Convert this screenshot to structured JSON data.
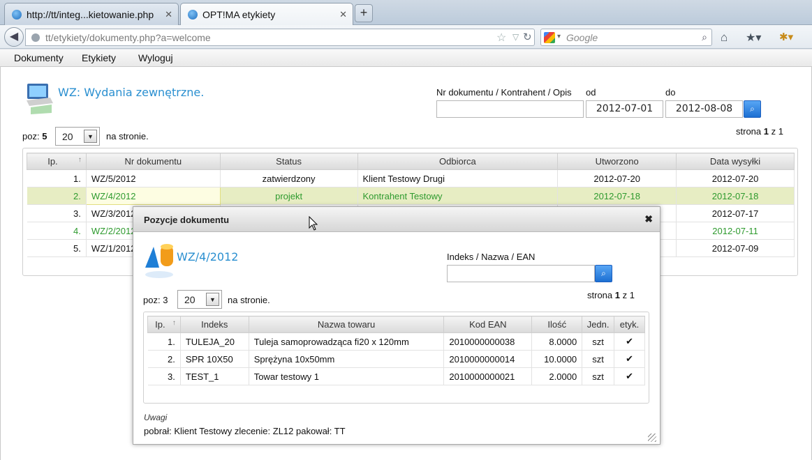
{
  "browser": {
    "tabs": [
      {
        "title": "http://tt/integ...kietowanie.php",
        "active": false
      },
      {
        "title": "OPT!MA etykiety",
        "active": true
      }
    ],
    "url": "tt/etykiety/dokumenty.php?a=welcome",
    "search_placeholder": "Google"
  },
  "menu": [
    "Dokumenty",
    "Etykiety",
    "Wyloguj"
  ],
  "page": {
    "title": "WZ: Wydania zewnętrzne.",
    "filter": {
      "search_label": "Nr dokumentu / Kontrahent / Opis",
      "search_value": "",
      "from_label": "od",
      "from_value": "2012-07-01",
      "to_label": "do",
      "to_value": "2012-08-08"
    },
    "poz_label": "poz:",
    "poz_count": "5",
    "per_page": "20",
    "per_page_suffix": "na stronie.",
    "pagination": {
      "prefix": "strona",
      "current": "1",
      "sep": "z",
      "total": "1"
    },
    "table": {
      "columns": [
        "Ip.",
        "Nr dokumentu",
        "Status",
        "Odbiorca",
        "Utworzono",
        "Data wysyłki"
      ],
      "rows": [
        {
          "lp": "1.",
          "nr": "WZ/5/2012",
          "status": "zatwierdzony",
          "odbiorca": "Klient Testowy Drugi",
          "utworzono": "2012-07-20",
          "wysylka": "2012-07-20"
        },
        {
          "lp": "2.",
          "nr": "WZ/4/2012",
          "status": "projekt",
          "odbiorca": "Kontrahent Testowy",
          "utworzono": "2012-07-18",
          "wysylka": "2012-07-18"
        },
        {
          "lp": "3.",
          "nr": "WZ/3/2012",
          "status": "",
          "odbiorca": "",
          "utworzono": "",
          "wysylka": "2012-07-17"
        },
        {
          "lp": "4.",
          "nr": "WZ/2/2012",
          "status": "",
          "odbiorca": "",
          "utworzono": "",
          "wysylka": "2012-07-11"
        },
        {
          "lp": "5.",
          "nr": "WZ/1/2012",
          "status": "",
          "odbiorca": "",
          "utworzono": "",
          "wysylka": "2012-07-09"
        }
      ]
    }
  },
  "modal": {
    "title": "Pozycje dokumentu",
    "doc_number": "WZ/4/2012",
    "search_label": "Indeks / Nazwa / EAN",
    "search_value": "",
    "poz_label": "poz:",
    "poz_count": "3",
    "per_page": "20",
    "per_page_suffix": "na stronie.",
    "pagination": {
      "prefix": "strona",
      "current": "1",
      "sep": "z",
      "total": "1"
    },
    "table": {
      "columns": [
        "Ip.",
        "Indeks",
        "Nazwa towaru",
        "Kod EAN",
        "Ilość",
        "Jedn.",
        "etyk."
      ],
      "rows": [
        {
          "lp": "1.",
          "indeks": "TULEJA_20",
          "nazwa": "Tuleja samoprowadząca fi20 x 120mm",
          "ean": "2010000000038",
          "ilosc": "8.0000",
          "jedn": "szt",
          "etyk": "✔"
        },
        {
          "lp": "2.",
          "indeks": "SPR 10X50",
          "nazwa": "Sprężyna 10x50mm",
          "ean": "2010000000014",
          "ilosc": "10.0000",
          "jedn": "szt",
          "etyk": "✔"
        },
        {
          "lp": "3.",
          "indeks": "TEST_1",
          "nazwa": "Towar testowy 1",
          "ean": "2010000000021",
          "ilosc": "2.0000",
          "jedn": "szt",
          "etyk": "✔"
        }
      ]
    },
    "notes_label": "Uwagi",
    "notes_text": "pobrał: Klient Testowy zlecenie: ZL12 pakował: TT"
  },
  "colors": {
    "accent": "#2a8fd0",
    "selected_row": "#e7edc3",
    "green_text": "#2e9a2e"
  },
  "icons": [
    "globe-icon",
    "star-icon",
    "reload-icon",
    "search-icon",
    "home-icon",
    "bookmarks-icon",
    "sort-asc-icon",
    "close-icon",
    "checkmark-icon"
  ]
}
